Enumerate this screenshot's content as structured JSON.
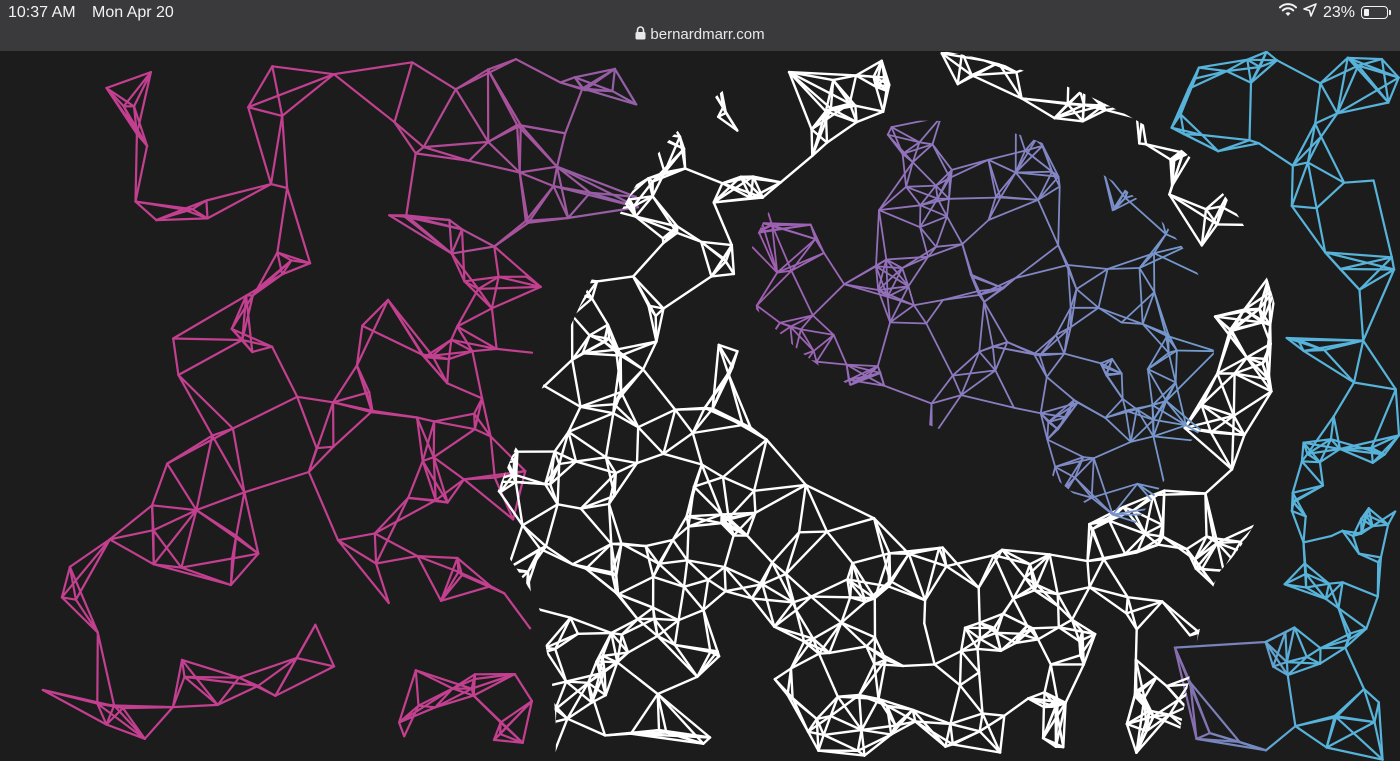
{
  "status_bar": {
    "time": "10:37 AM",
    "date": "Mon Apr 20",
    "battery_text": "23%",
    "battery_level": 0.23,
    "icons": [
      "wifi-icon",
      "location-arrow-icon",
      "battery-icon"
    ]
  },
  "address_bar": {
    "url": "bernardmarr.com",
    "icon": "lock-icon"
  },
  "artwork": {
    "description_colors": {
      "background": "#1c1c1c",
      "left_mesh": "#c2408f",
      "purple_mesh": "#8f63a8",
      "head_mesh": "#ffffff",
      "brain_mesh": "#7b7fbf",
      "right_mesh": "#57b3d9"
    }
  }
}
